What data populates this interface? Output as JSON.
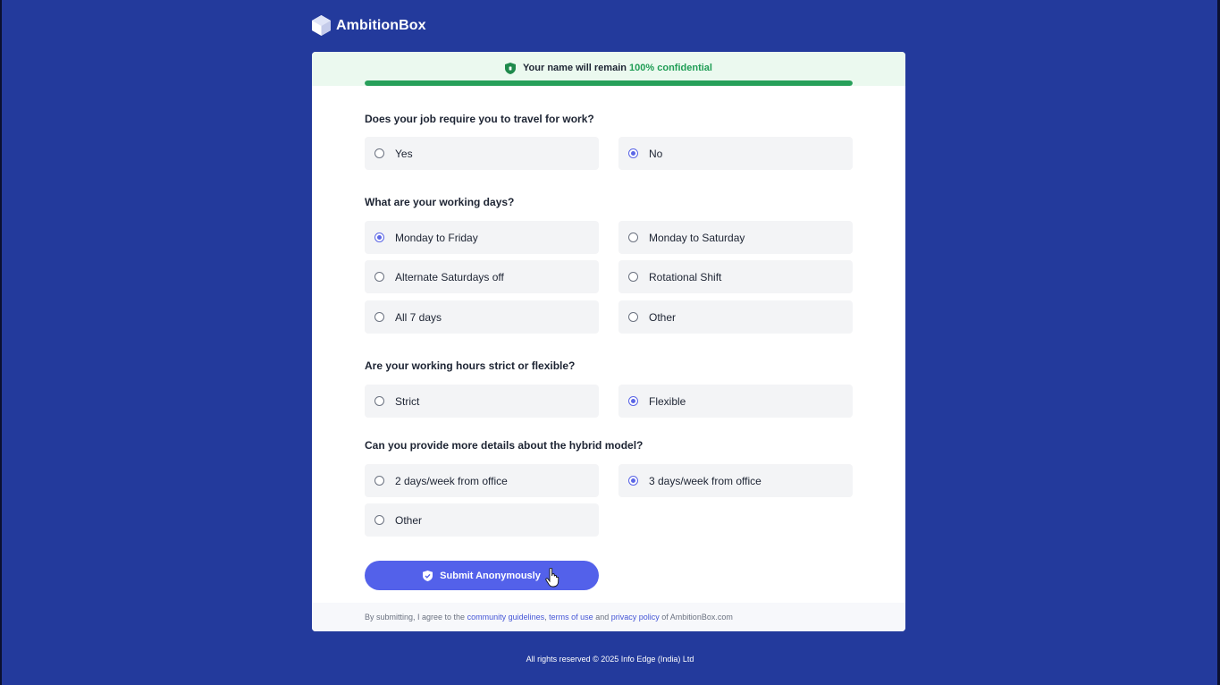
{
  "brand": {
    "name": "AmbitionBox"
  },
  "confidential": {
    "prefix": "Your name will remain",
    "highlight": "100% confidential"
  },
  "progress": {
    "fraction": 1.0,
    "color": "#27a05a"
  },
  "questions": [
    {
      "text": "Does your job require you to travel for work?",
      "options": [
        {
          "label": "Yes",
          "selected": false
        },
        {
          "label": "No",
          "selected": true
        }
      ]
    },
    {
      "text": "What are your working days?",
      "options": [
        {
          "label": "Monday to Friday",
          "selected": true
        },
        {
          "label": "Monday to Saturday",
          "selected": false
        },
        {
          "label": "Alternate Saturdays off",
          "selected": false
        },
        {
          "label": "Rotational Shift",
          "selected": false
        },
        {
          "label": "All 7 days",
          "selected": false
        },
        {
          "label": "Other",
          "selected": false
        }
      ]
    },
    {
      "text": "Are your working hours strict or flexible?",
      "options": [
        {
          "label": "Strict",
          "selected": false
        },
        {
          "label": "Flexible",
          "selected": true
        }
      ]
    },
    {
      "text": "Can you provide more details about the hybrid model?",
      "options": [
        {
          "label": "2 days/week from office",
          "selected": false
        },
        {
          "label": "3 days/week from office",
          "selected": true
        },
        {
          "label": "Other",
          "selected": false
        }
      ]
    }
  ],
  "submit": {
    "label": "Submit Anonymously",
    "icon": "shield-check-icon"
  },
  "terms": {
    "prefix": "By submitting, I agree to the",
    "community": "community guidelines",
    "sep1": ",",
    "tou": "terms of use",
    "and": "and",
    "privacy": "privacy policy",
    "suffix": "of AmbitionBox.com"
  },
  "footer": {
    "text": "All rights reserved © 2025 Info Edge (India) Ltd"
  },
  "colors": {
    "background": "#233a9c",
    "accent": "#5361ea",
    "success": "#1f9d55"
  }
}
